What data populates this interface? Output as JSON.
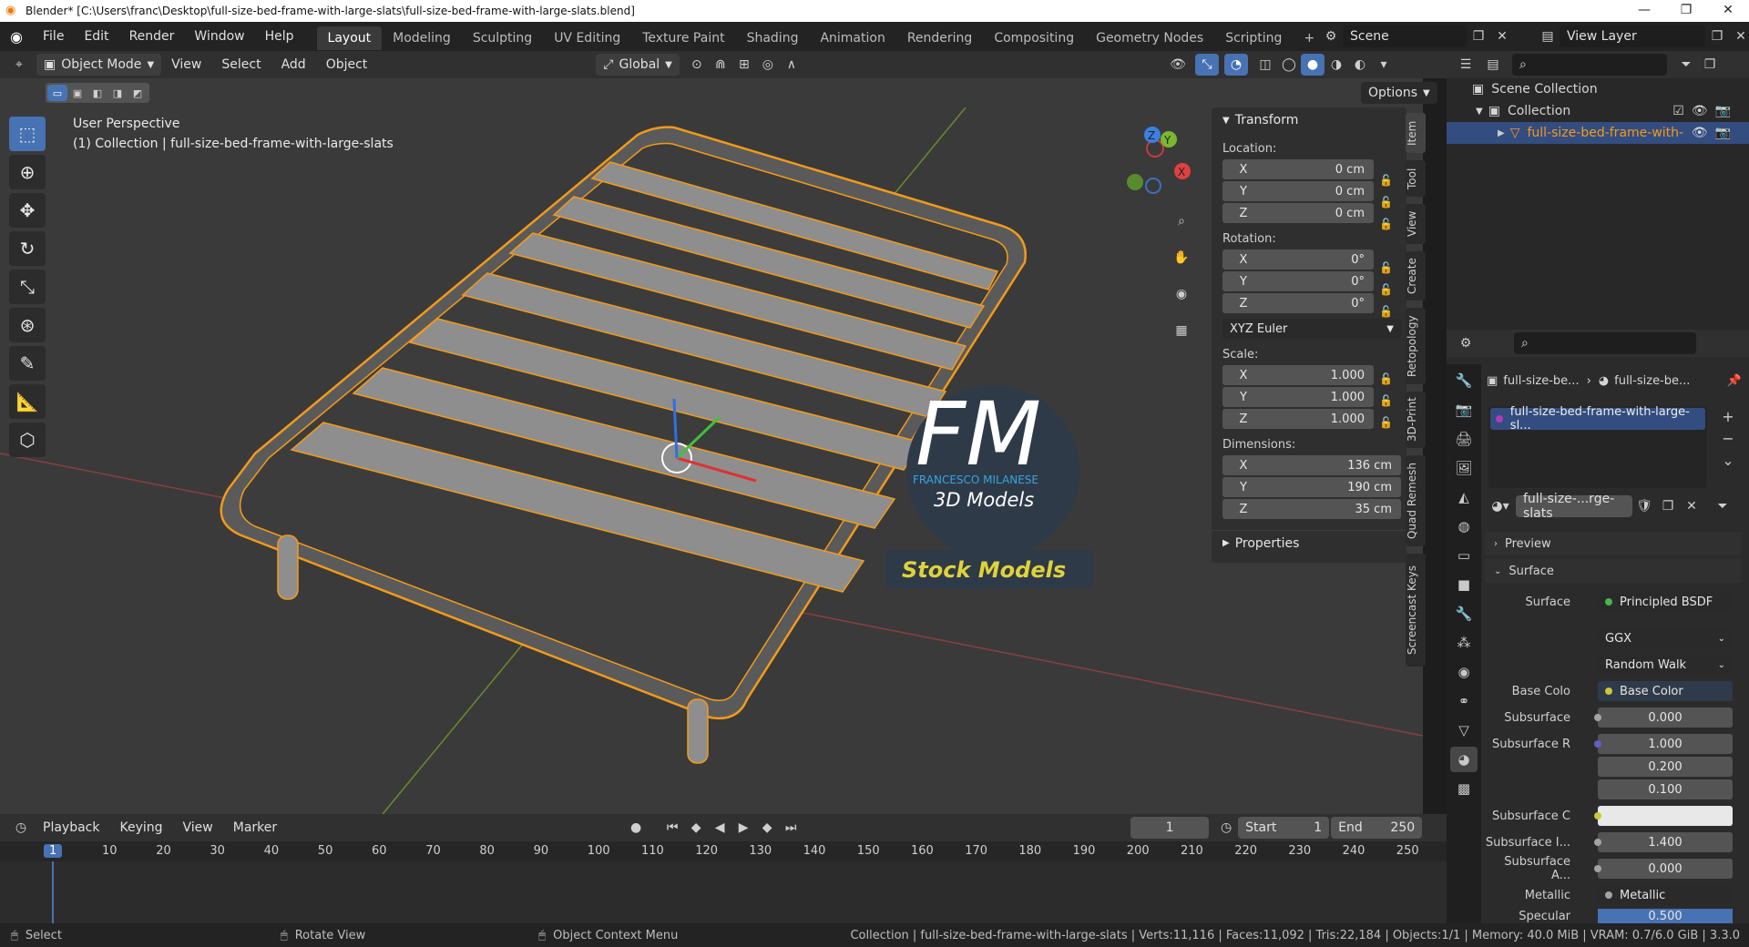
{
  "title_bar": {
    "title": "Blender* [C:\\Users\\franc\\Desktop\\full-size-bed-frame-with-large-slats\\full-size-bed-frame-with-large-slats.blend]",
    "minimize": "—",
    "maximize": "❐",
    "close": "✕"
  },
  "menu": {
    "items": [
      "File",
      "Edit",
      "Render",
      "Window",
      "Help"
    ]
  },
  "workspaces": {
    "tabs": [
      "Layout",
      "Modeling",
      "Sculpting",
      "UV Editing",
      "Texture Paint",
      "Shading",
      "Animation",
      "Rendering",
      "Compositing",
      "Geometry Nodes",
      "Scripting"
    ],
    "active": "Layout",
    "add": "+"
  },
  "scene": {
    "label": "Scene",
    "view_layer": "View Layer"
  },
  "viewport_header": {
    "mode": "Object Mode",
    "menus": [
      "View",
      "Select",
      "Add",
      "Object"
    ],
    "transform_orientation": "Global",
    "options": "Options"
  },
  "viewport": {
    "perspective": "User Perspective",
    "collection_info": "(1) Collection | full-size-bed-frame-with-large-slats",
    "watermark_letters": "FM",
    "watermark_name": "FRANCESCO MILANESE",
    "watermark_sub": "3D Models",
    "watermark_banner": "Stock Models",
    "colors": {
      "bg": "#3a3a3a",
      "slat": "#8e8e8e",
      "outline": "#f39a1a",
      "grid_red": "#8a3a3a",
      "grid_green": "#5e7a2a"
    }
  },
  "gizmo": {
    "x": "X",
    "y": "Y",
    "z": "Z"
  },
  "n_panel": {
    "header": "Transform",
    "location_label": "Location:",
    "location": [
      {
        "axis": "X",
        "value": "0 cm"
      },
      {
        "axis": "Y",
        "value": "0 cm"
      },
      {
        "axis": "Z",
        "value": "0 cm"
      }
    ],
    "rotation_label": "Rotation:",
    "rotation": [
      {
        "axis": "X",
        "value": "0°"
      },
      {
        "axis": "Y",
        "value": "0°"
      },
      {
        "axis": "Z",
        "value": "0°"
      }
    ],
    "rotation_mode": "XYZ Euler",
    "scale_label": "Scale:",
    "scale": [
      {
        "axis": "X",
        "value": "1.000"
      },
      {
        "axis": "Y",
        "value": "1.000"
      },
      {
        "axis": "Z",
        "value": "1.000"
      }
    ],
    "dimensions_label": "Dimensions:",
    "dimensions": [
      {
        "axis": "X",
        "value": "136 cm"
      },
      {
        "axis": "Y",
        "value": "190 cm"
      },
      {
        "axis": "Z",
        "value": "35 cm"
      }
    ],
    "properties": "Properties",
    "side_tabs": [
      "Item",
      "Tool",
      "View",
      "Create",
      "Retopology",
      "3D-Print",
      "Quad Remesh",
      "Screencast Keys"
    ]
  },
  "outliner": {
    "scene_collection": "Scene Collection",
    "collection": "Collection",
    "object": "full-size-bed-frame-with-"
  },
  "properties": {
    "breadcrumb_obj": "full-size-be...",
    "breadcrumb_mat": "full-size-be...",
    "material_slot": "full-size-bed-frame-with-large-sl...",
    "material_name": "full-size-...rge-slats",
    "preview": "Preview",
    "surface_section": "Surface",
    "rows": [
      {
        "label": "Surface",
        "value": "Principled BSDF",
        "dot": "#46b64e"
      },
      {
        "label": "",
        "value": "GGX",
        "dot": ""
      },
      {
        "label": "",
        "value": "Random Walk",
        "dot": ""
      },
      {
        "label": "Base Colo",
        "value": "Base Color",
        "dot": "#cfc53b"
      },
      {
        "label": "Subsurface",
        "value": "0.000",
        "dot": "#a3a3a3"
      },
      {
        "label": "Subsurface R",
        "value": "1.000",
        "dot": "#6060c9"
      },
      {
        "label": "",
        "value": "0.200",
        "dot": ""
      },
      {
        "label": "",
        "value": "0.100",
        "dot": ""
      },
      {
        "label": "Subsurface C",
        "value": "",
        "dot": "#cfc53b"
      },
      {
        "label": "Subsurface I...",
        "value": "1.400",
        "dot": "#a3a3a3"
      },
      {
        "label": "Subsurface A...",
        "value": "0.000",
        "dot": "#a3a3a3"
      },
      {
        "label": "Metallic",
        "value": "Metallic",
        "dot": "#a3a3a3"
      },
      {
        "label": "Specular",
        "value": "0.500",
        "dot": "#a3a3a3"
      }
    ]
  },
  "timeline": {
    "menus": [
      "Playback",
      "Keying",
      "View",
      "Marker"
    ],
    "current_frame": "1",
    "start_label": "Start",
    "start": "1",
    "end_label": "End",
    "end": "250",
    "ticks": [
      "1",
      "10",
      "20",
      "30",
      "40",
      "50",
      "60",
      "70",
      "80",
      "90",
      "100",
      "110",
      "120",
      "130",
      "140",
      "150",
      "160",
      "170",
      "180",
      "190",
      "200",
      "210",
      "220",
      "230",
      "240",
      "250"
    ]
  },
  "status_bar": {
    "select": "Select",
    "rotate": "Rotate View",
    "context": "Object Context Menu",
    "stats": "Collection | full-size-bed-frame-with-large-slats | Verts:11,116 | Faces:11,092 | Tris:22,184 | Objects:1/1 | Memory: 40.0 MiB | VRAM: 0.7/6.0 GiB | 3.3.0"
  }
}
